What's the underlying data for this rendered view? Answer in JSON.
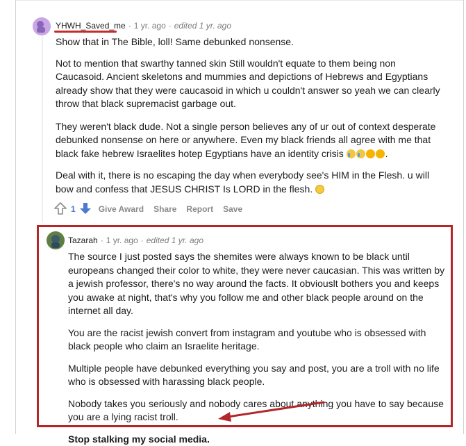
{
  "comment1": {
    "username": "YHWH_Saved_me",
    "time": "1 yr. ago",
    "edited": "edited 1 yr. ago",
    "paragraphs": [
      "Show that in The Bible, loll! Same debunked nonsense.",
      "Not to mention that swarthy tanned skin Still wouldn't equate to them being non Caucasoid. Ancient skeletons and mummies and depictions of Hebrews and Egyptians already show that they were caucasoid in which u couldn't answer so yeah we can clearly throw that black supremacist garbage out.",
      "They weren't black dude. Not a single person believes any of ur out of context desperate debunked nonsense on here or anywhere. Even my black friends all agree with me that black fake hebrew Israelites hotep Egyptians have an identity crisis",
      "Deal with it, there is no escaping the day when everybody see's HIM in the Flesh. u will bow and confess that JESUS CHRIST Is LORD in the flesh."
    ],
    "para3_end": ".",
    "vote_count": "1",
    "actions": {
      "give_award": "Give Award",
      "share": "Share",
      "report": "Report",
      "save": "Save"
    }
  },
  "comment2": {
    "username": "Tazarah",
    "time": "1 yr. ago",
    "edited": "edited 1 yr. ago",
    "paragraphs": [
      "The source I just posted says the shemites were always known to be black until europeans changed their color to white, they were never caucasian. This was written by a jewish professor, there's no way around the facts. It obviouslt bothers you and keeps you awake at night, that's why you follow me and other black people around on the internet all day.",
      "You are the racist jewish convert from instagram and youtube who is obsessed with black people who claim an Israelite heritage.",
      "Multiple people have debunked everything you say and post, you are a troll with no life who is obsessed with harassing black people.",
      "Nobody takes you seriously and nobody cares about anything you have to say because you are a lying racist troll."
    ],
    "bold_line": "Stop stalking my social media."
  },
  "colors": {
    "annotation_red": "#b3262a",
    "upvote_gray": "#878a8c",
    "downvote_blue": "#4a7bd1"
  }
}
